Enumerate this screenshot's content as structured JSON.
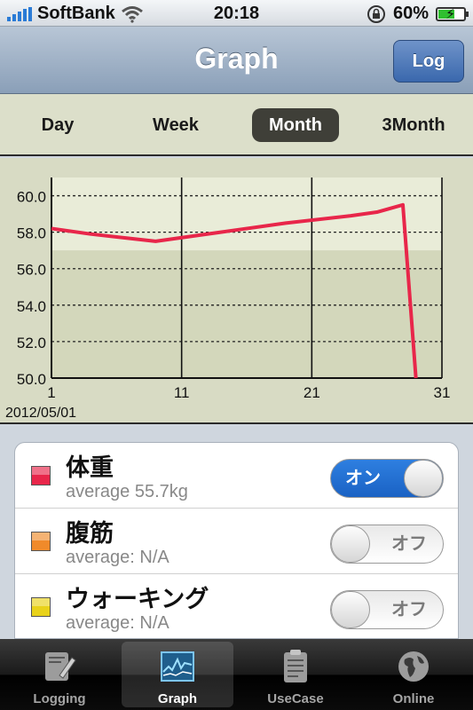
{
  "status": {
    "carrier": "SoftBank",
    "time": "20:18",
    "battery": "60%",
    "battery_level": 0.6
  },
  "navbar": {
    "title": "Graph",
    "log_button": "Log"
  },
  "range_tabs": [
    {
      "label": "Day",
      "active": false
    },
    {
      "label": "Week",
      "active": false
    },
    {
      "label": "Month",
      "active": true
    },
    {
      "label": "3Month",
      "active": false
    }
  ],
  "chart_data": {
    "type": "line",
    "start_date": "2012/05/01",
    "x_ticks": [
      "1",
      "11",
      "21",
      "31"
    ],
    "y_ticks": [
      "50.0",
      "52.0",
      "54.0",
      "56.0",
      "58.0",
      "60.0"
    ],
    "xlim": [
      1,
      31
    ],
    "ylim": [
      50,
      61
    ],
    "series": [
      {
        "name": "体重",
        "color": "#e8264a",
        "x": [
          1,
          4,
          9,
          14,
          19,
          24,
          26,
          28,
          29
        ],
        "y": [
          58.2,
          57.9,
          57.5,
          58.0,
          58.5,
          58.9,
          59.1,
          59.5,
          50.0
        ]
      }
    ]
  },
  "legend_items": [
    {
      "name": "体重",
      "average": "average 55.7kg",
      "color": "#e8264a",
      "toggle": "オン",
      "on": true
    },
    {
      "name": "腹筋",
      "average": "average: N/A",
      "color": "#f08a2a",
      "toggle": "オフ",
      "on": false
    },
    {
      "name": "ウォーキング",
      "average": "average: N/A",
      "color": "#e9d21a",
      "toggle": "オフ",
      "on": false
    }
  ],
  "tabbar": [
    {
      "label": "Logging",
      "icon": "pencil-paper-icon",
      "active": false
    },
    {
      "label": "Graph",
      "icon": "graph-icon",
      "active": true
    },
    {
      "label": "UseCase",
      "icon": "clipboard-icon",
      "active": false
    },
    {
      "label": "Online",
      "icon": "globe-icon",
      "active": false
    }
  ]
}
